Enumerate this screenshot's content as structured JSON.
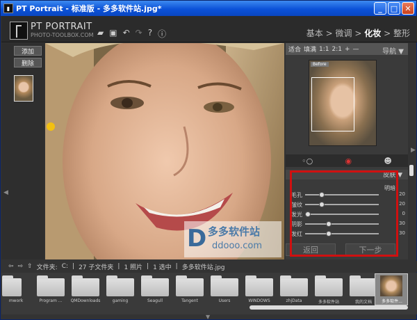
{
  "window": {
    "title": "PT Portrait - 标准版 - 多多软件站.jpg*",
    "minimize": "_",
    "maximize": "□",
    "close": "✕"
  },
  "header": {
    "logo_title": "PT PORTRAIT",
    "logo_subtitle": "PHOTO-TOOLBOX.COM",
    "steps": [
      "基本",
      "微调",
      "化妆",
      "整形"
    ],
    "active_step": "化妆",
    "separator": ">"
  },
  "left": {
    "add_label": "添加",
    "delete_label": "删除"
  },
  "navigator": {
    "fit": "适合",
    "fill": "填满",
    "z1": "1:1",
    "z2": "2:1",
    "plus": "+",
    "minus": "—",
    "title": "导航",
    "before": "Before"
  },
  "skin": {
    "title": "皮肤",
    "subtitle": "明暗",
    "sliders": [
      {
        "label": "毛孔",
        "value": "20",
        "pos": 0.2
      },
      {
        "label": "皱纹",
        "value": "20",
        "pos": 0.2
      },
      {
        "label": "发光",
        "value": "0",
        "pos": 0.0
      },
      {
        "label": "阴影",
        "value": "30",
        "pos": 0.3
      },
      {
        "label": "发红",
        "value": "30",
        "pos": 0.3
      }
    ],
    "back_label": "返回",
    "next_label": "下一步"
  },
  "pathbar": {
    "folder_label": "文件夹:",
    "drive": "C:",
    "subfolders": "27 子文件夹",
    "photos": "1 照片",
    "selected": "1 选中",
    "filename": "多多软件站.jpg"
  },
  "strip": {
    "folders": [
      "mwork",
      "Program ...",
      "QMDownloads",
      "gaming",
      "Seagull",
      "Tangent",
      "Users",
      "WINDOWS",
      "zhjData",
      "多多软件站",
      "我的文档",
      "多多软件..."
    ]
  },
  "watermark": {
    "text": "多多软件站",
    "url": "ddooo.com"
  }
}
